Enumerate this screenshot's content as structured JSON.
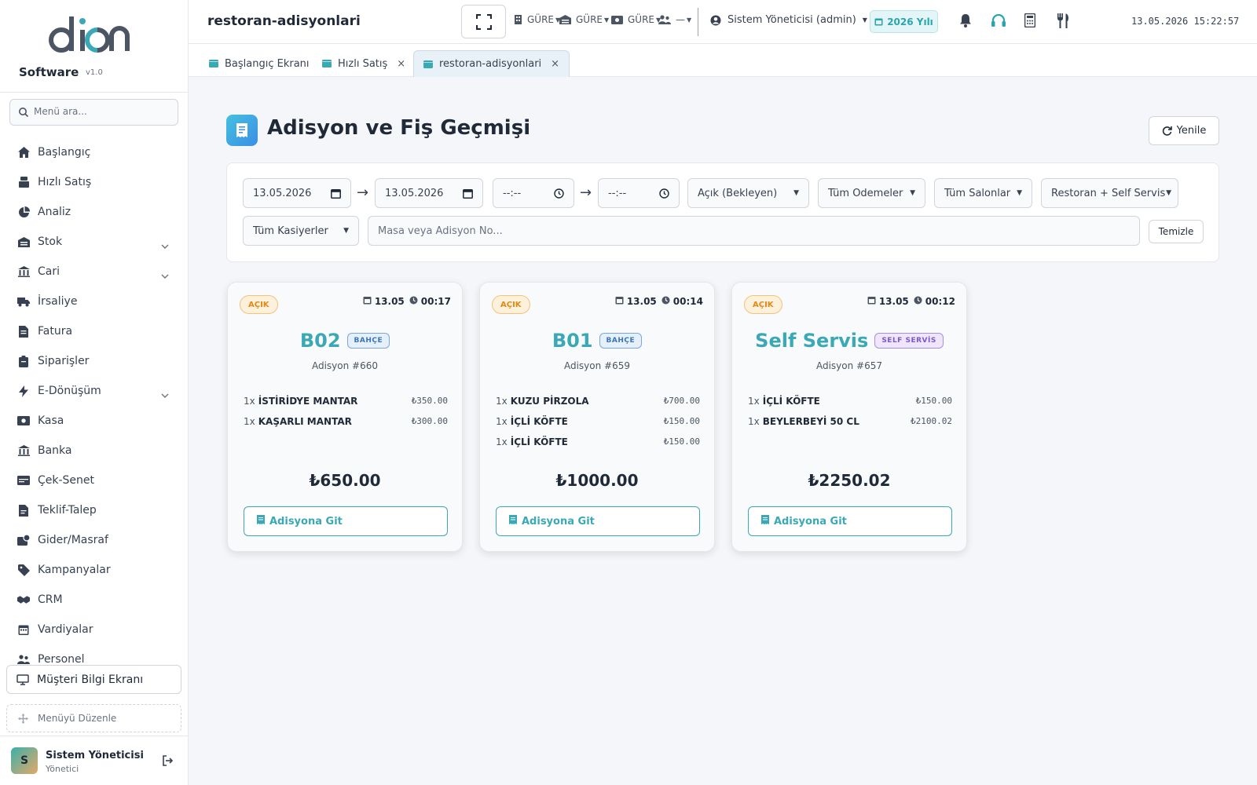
{
  "sidebar": {
    "brand": "Software",
    "version": "v1.0",
    "search_placeholder": "Menü ara...",
    "items": [
      {
        "label": "Başlangıç",
        "icon": "home-icon",
        "expandable": false
      },
      {
        "label": "Hızlı Satış",
        "icon": "cash-register-icon",
        "expandable": false
      },
      {
        "label": "Analiz",
        "icon": "pie-chart-icon",
        "expandable": false
      },
      {
        "label": "Stok",
        "icon": "warehouse-icon",
        "expandable": true
      },
      {
        "label": "Cari",
        "icon": "building-icon",
        "expandable": true
      },
      {
        "label": "İrsaliye",
        "icon": "truck-icon",
        "expandable": false
      },
      {
        "label": "Fatura",
        "icon": "invoice-icon",
        "expandable": false
      },
      {
        "label": "Siparişler",
        "icon": "clipboard-icon",
        "expandable": false
      },
      {
        "label": "E-Dönüşüm",
        "icon": "bolt-icon",
        "expandable": true
      },
      {
        "label": "Kasa",
        "icon": "money-icon",
        "expandable": false
      },
      {
        "label": "Banka",
        "icon": "bank-icon",
        "expandable": false
      },
      {
        "label": "Çek-Senet",
        "icon": "card-icon",
        "expandable": false
      },
      {
        "label": "Teklif-Talep",
        "icon": "file-icon",
        "expandable": false
      },
      {
        "label": "Gider/Masraf",
        "icon": "expense-icon",
        "expandable": false
      },
      {
        "label": "Kampanyalar",
        "icon": "tag-icon",
        "expandable": false
      },
      {
        "label": "CRM",
        "icon": "handshake-icon",
        "expandable": false
      },
      {
        "label": "Vardiyalar",
        "icon": "calendar-icon",
        "expandable": false
      },
      {
        "label": "Personel",
        "icon": "users-icon",
        "expandable": false
      }
    ],
    "customer_display_label": "Müşteri Bilgi Ekranı",
    "edit_menu_label": "Menüyü Düzenle",
    "user": {
      "initial": "S",
      "name": "Sistem Yöneticisi",
      "role": "Yönetici"
    }
  },
  "topbar": {
    "page_name": "restoran-adisyonlari",
    "quick_selects": [
      {
        "icon": "building-icon",
        "value": "GÜRE"
      },
      {
        "icon": "warehouse-icon",
        "value": "GÜRE"
      },
      {
        "icon": "money-icon",
        "value": "GÜRE"
      },
      {
        "icon": "users-icon",
        "value": "—"
      }
    ],
    "user_label": "Sistem Yöneticisi (admin)",
    "year_label": "2026 Yılı",
    "datetime": "13.05.2026 15:22:57"
  },
  "tabs": [
    {
      "label": "Başlangıç Ekranı",
      "closable": false,
      "active": false
    },
    {
      "label": "Hızlı Satış",
      "closable": true,
      "active": false
    },
    {
      "label": "restoran-adisyonlari",
      "closable": true,
      "active": true
    }
  ],
  "main": {
    "title": "Adisyon ve Fiş Geçmişi",
    "refresh_label": "Yenile",
    "filters": {
      "date_from": "13.05.2026",
      "date_to": "13.05.2026",
      "time_from": "--:--",
      "time_to": "--:--",
      "status": "Açık (Bekleyen)",
      "payment": "Tüm Ödemeler",
      "salon": "Tüm Salonlar",
      "mode": "Restoran + Self Servis",
      "cashier": "Tüm Kasiyerler",
      "search_placeholder": "Masa veya Adisyon No...",
      "clear_label": "Temizle"
    },
    "cards": [
      {
        "status": "AÇIK",
        "date": "13.05",
        "time": "00:17",
        "table": "B02",
        "area": "BAHÇE",
        "area_type": "bahce",
        "adisyon": "Adisyon #660",
        "items": [
          {
            "qty": "1x",
            "name": "İSTİRİDYE MANTAR",
            "price": "₺350.00"
          },
          {
            "qty": "1x",
            "name": "KAŞARLI MANTAR",
            "price": "₺300.00"
          }
        ],
        "total": "₺650.00",
        "button": "Adisyona Git"
      },
      {
        "status": "AÇIK",
        "date": "13.05",
        "time": "00:14",
        "table": "B01",
        "area": "BAHÇE",
        "area_type": "bahce",
        "adisyon": "Adisyon #659",
        "items": [
          {
            "qty": "1x",
            "name": "KUZU PİRZOLA",
            "price": "₺700.00"
          },
          {
            "qty": "1x",
            "name": "İÇLİ KÖFTE",
            "price": "₺150.00"
          },
          {
            "qty": "1x",
            "name": "İÇLİ KÖFTE",
            "price": "₺150.00"
          }
        ],
        "total": "₺1000.00",
        "button": "Adisyona Git"
      },
      {
        "status": "AÇIK",
        "date": "13.05",
        "time": "00:12",
        "table": "Self Servis",
        "area": "SELF SERVİS",
        "area_type": "self",
        "adisyon": "Adisyon #657",
        "items": [
          {
            "qty": "1x",
            "name": "İÇLİ KÖFTE",
            "price": "₺150.00"
          },
          {
            "qty": "1x",
            "name": "BEYLERBEYİ 50 CL",
            "price": "₺2100.02"
          }
        ],
        "total": "₺2250.02",
        "button": "Adisyona Git"
      }
    ]
  },
  "colors": {
    "accent": "#3aa8b5",
    "open_status": "#e08a14",
    "bahce_badge": "#3b76b8",
    "self_badge": "#7c58c9"
  }
}
